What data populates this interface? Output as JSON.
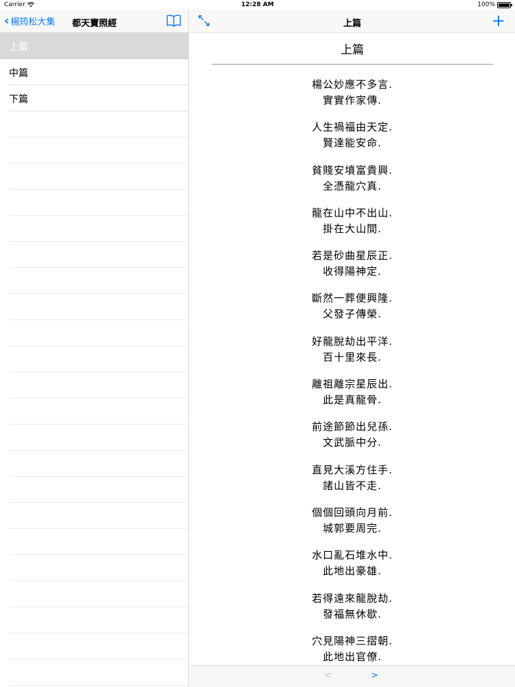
{
  "status_bar": {
    "carrier": "Carrier",
    "time": "12:28 AM",
    "battery": "100%",
    "battery_level": 1.0
  },
  "master": {
    "back_label": "楊筠松大集",
    "title": "都天寶照經",
    "chapters": [
      {
        "label": "上篇",
        "selected": true
      },
      {
        "label": "中篇",
        "selected": false
      },
      {
        "label": "下篇",
        "selected": false
      }
    ]
  },
  "detail": {
    "title": "上篇",
    "heading": "上篇",
    "verses": [
      [
        "楊公妙應不多言.",
        "實實作家傳."
      ],
      [
        "人生禍福由天定.",
        "賢達能安命."
      ],
      [
        "貧賤安墳富貴興.",
        "全憑龍穴真."
      ],
      [
        "龍在山中不出山.",
        "掛在大山間."
      ],
      [
        "若是砂曲星辰正.",
        "收得陽神定."
      ],
      [
        "斷然一葬便興隆.",
        "父發子傳榮."
      ],
      [
        "好龍脫劫出平洋.",
        "百十里來長."
      ],
      [
        "離祖離宗星辰出.",
        "此是真龍骨."
      ],
      [
        "前途節節出兒孫.",
        "文武脈中分."
      ],
      [
        "直見大溪方住手.",
        "諸山皆不走."
      ],
      [
        "個個回頭向月前.",
        "城郭要周完."
      ],
      [
        "水口亂石堆水中.",
        "此地出豪雄."
      ],
      [
        "若得遠來龍脫劫.",
        "發福無休歇."
      ],
      [
        "穴見陽神三摺朝.",
        "此地出官僚."
      ]
    ],
    "add_label": "+",
    "prev_label": "<",
    "next_label": ">"
  },
  "colors": {
    "accent": "#0a7aff",
    "selected_row": "#d9d9d9"
  }
}
